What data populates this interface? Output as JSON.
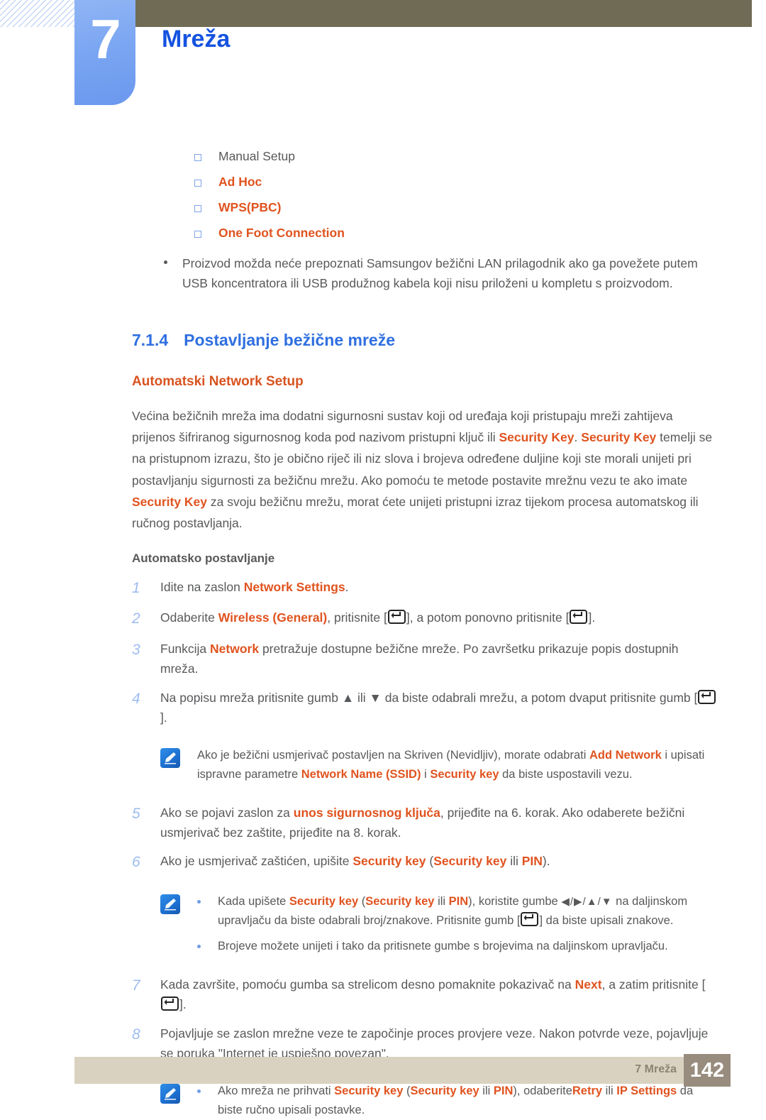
{
  "header": {
    "chapter_number": "7",
    "chapter_title": "Mreža"
  },
  "options_list": [
    {
      "label": "Manual Setup",
      "highlight": false
    },
    {
      "label": "Ad Hoc",
      "highlight": true
    },
    {
      "label": "WPS(PBC)",
      "highlight": true
    },
    {
      "label": "One Foot Connection",
      "highlight": true
    }
  ],
  "intro_bullet": "Proizvod možda neće prepoznati Samsungov bežični LAN prilagodnik ako ga povežete putem USB koncentratora ili USB produžnog kabela koji nisu priloženi u kompletu s proizvodom.",
  "section": {
    "number": "7.1.4",
    "title": "Postavljanje bežične mreže",
    "subtitle": "Automatski Network Setup"
  },
  "paragraph": {
    "p1": "Većina bežičnih mreža ima dodatni sigurnosni sustav koji od uređaja koji pristupaju mreži zahtijeva prijenos šifriranog sigurnosnog koda pod nazivom pristupni ključ ili ",
    "k1": "Security Key",
    "p2": ". ",
    "k2": "Security Key",
    "p3": " temelji se na pristupnom izrazu, što je obično riječ ili niz slova i brojeva određene duljine koji ste morali unijeti pri postavljanju sigurnosti za bežičnu mrežu. Ako pomoću te metode postavite mrežnu vezu te ako imate ",
    "k3": "Security Key",
    "p4": " za svoju bežičnu mrežu, morat ćete unijeti pristupni izraz tijekom procesa automatskog ili ručnog postavljanja."
  },
  "steps_heading": "Automatsko postavljanje",
  "steps": {
    "s1": {
      "num": "1",
      "a": "Idite na zaslon ",
      "k": "Network Settings",
      "b": "."
    },
    "s2": {
      "num": "2",
      "a": "Odaberite ",
      "k": "Wireless (General)",
      "b": ", pritisnite [",
      "c": "], a potom ponovno pritisnite [",
      "d": "]."
    },
    "s3": {
      "num": "3",
      "a": "Funkcija ",
      "k": "Network",
      "b": " pretražuje dostupne bežične mreže. Po završetku prikazuje popis dostupnih mreža."
    },
    "s4": {
      "num": "4",
      "a": "Na popisu mreža pritisnite gumb ",
      "up": "▲",
      "mid": " ili ",
      "down": "▼",
      "b": " da biste odabrali mrežu, a potom dvaput pritisnite gumb [",
      "c": "]."
    },
    "s5": {
      "num": "5",
      "a": "Ako se pojavi zaslon za ",
      "k": "unos sigurnosnog ključa",
      "b": ", prijeđite na 6. korak. Ako odaberete bežični usmjerivač bez zaštite, prijeđite na 8. korak."
    },
    "s6": {
      "num": "6",
      "a": "Ako je usmjerivač zaštićen, upišite ",
      "k1": "Security key",
      "b": " (",
      "k2": "Security key",
      "c": " ili ",
      "k3": "PIN",
      "d": ")."
    },
    "s7": {
      "num": "7",
      "a": "Kada završite, pomoću gumba sa strelicom desno pomaknite pokazivač na ",
      "k": "Next",
      "b": ", a zatim pritisnite [",
      "c": "]."
    },
    "s8": {
      "num": "8",
      "a": "Pojavljuje se zaslon mrežne veze te započinje proces provjere veze. Nakon potvrde veze, pojavljuje se poruka \"Internet je uspješno povezan\"."
    }
  },
  "notes": {
    "n1": {
      "icon": "note-pencil-icon",
      "a": "Ako je bežični usmjerivač postavljen na Skriven (Nevidljiv), morate odabrati ",
      "k1": "Add Network",
      "b": " i upisati ispravne parametre ",
      "k2": "Network Name (SSID)",
      "c": " i ",
      "k3": "Security key",
      "d": " da biste uspostavili vezu."
    },
    "n2": {
      "icon": "note-pencil-icon",
      "b1": {
        "a": "Kada upišete ",
        "k1": "Security key",
        "b": " (",
        "k2": "Security key",
        "c": " ili ",
        "k3": "PIN",
        "d": "), koristite gumbe ",
        "arrows": "◀/▶/▲/▼",
        "e": " na daljinskom upravljaču da biste odabrali broj/znakove. Pritisnite gumb [",
        "f": "] da biste upisali znakove."
      },
      "b2": "Brojeve možete unijeti i tako da pritisnete gumbe s brojevima na daljinskom upravljaču."
    },
    "n3": {
      "icon": "note-pencil-icon",
      "a": "Ako mreža ne prihvati ",
      "k1": "Security key",
      "b": " (",
      "k2": "Security key",
      "c": " ili ",
      "k3": "PIN",
      "d": "), odaberite",
      "k4": "Retry",
      "e": " ili ",
      "k5": "IP Settings",
      "f": " da biste ručno upisali postavke."
    }
  },
  "footer": {
    "label": "7 Mreža",
    "page": "142"
  },
  "colors": {
    "accent_orange": "#e0531f",
    "accent_blue": "#2f6fe0",
    "olive": "#706b54",
    "footer_bg": "#d9d2c0",
    "footer_page_bg": "#988c7e",
    "tab_blue": "#7ba6f2"
  }
}
